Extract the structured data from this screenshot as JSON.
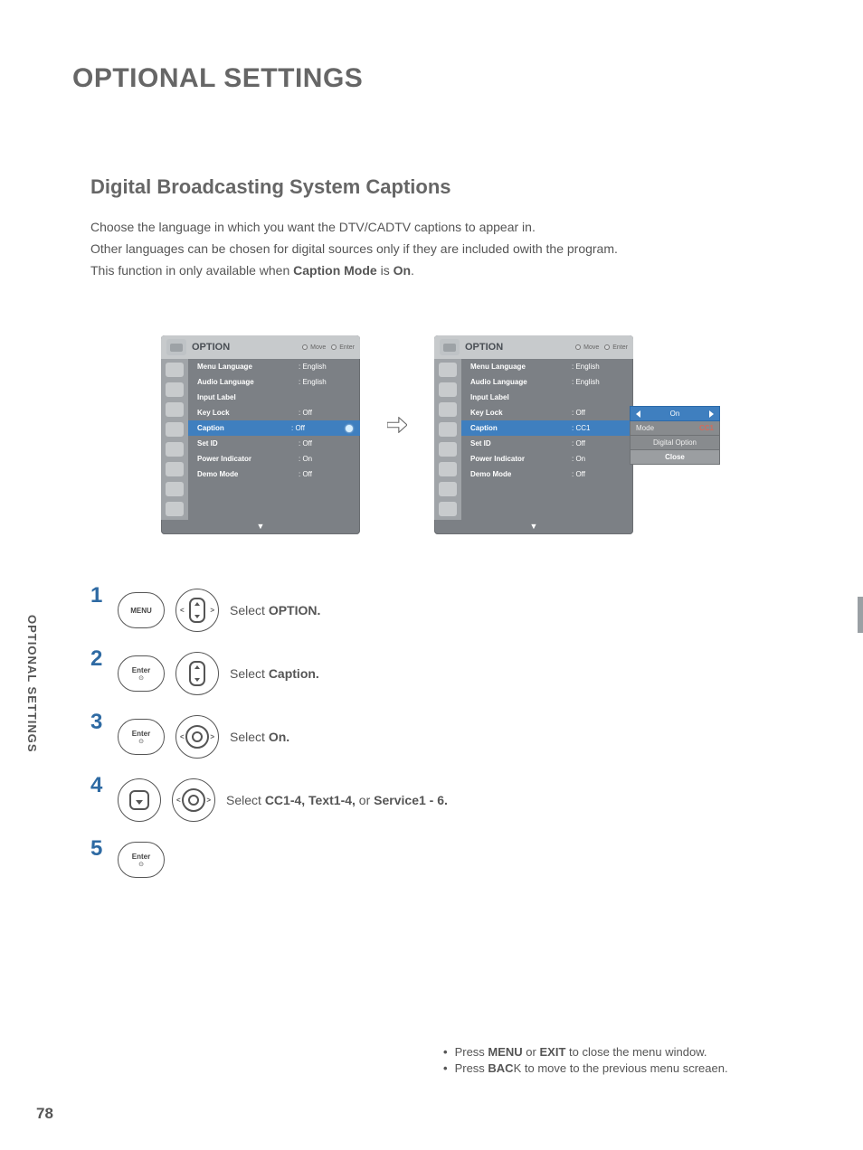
{
  "page_title": "OPTIONAL SETTINGS",
  "section_title": "Digital Broadcasting System Captions",
  "body_lines": [
    "Choose the language in which you want the DTV/CADTV captions to appear in.",
    "Other languages can be chosen for digital sources only if they are included owith the program."
  ],
  "body_suffix": {
    "pre": "This function in only available when ",
    "b1": "Caption Mode",
    "mid": " is ",
    "b2": "On",
    "post": "."
  },
  "osd": {
    "title": "OPTION",
    "move_hint": "Move",
    "enter_hint": "Enter",
    "rows_left": [
      {
        "label": "Menu Language",
        "val": ": English"
      },
      {
        "label": "Audio Language",
        "val": ": English"
      },
      {
        "label": "Input Label",
        "val": ""
      },
      {
        "label": "Key Lock",
        "val": ": Off"
      },
      {
        "label": "Caption",
        "val": ": Off",
        "sel": true,
        "dot": true
      },
      {
        "label": "Set ID",
        "val": ": Off"
      },
      {
        "label": "Power Indicator",
        "val": ": On"
      },
      {
        "label": "Demo Mode",
        "val": ": Off"
      }
    ],
    "rows_right": [
      {
        "label": "Menu Language",
        "val": ": English"
      },
      {
        "label": "Audio Language",
        "val": ": English"
      },
      {
        "label": "Input Label",
        "val": ""
      },
      {
        "label": "Key Lock",
        "val": ": Off"
      },
      {
        "label": "Caption",
        "val": ": CC1",
        "sel": true
      },
      {
        "label": "Set ID",
        "val": ": Off"
      },
      {
        "label": "Power Indicator",
        "val": ": On"
      },
      {
        "label": "Demo Mode",
        "val": ": Off"
      }
    ],
    "foot": "▼"
  },
  "popup": {
    "head": "On",
    "rows": [
      {
        "label": "Mode",
        "val": "CC1"
      },
      {
        "label": "Digital Option",
        "val": ""
      }
    ],
    "close": "Close"
  },
  "steps": [
    {
      "n": "1",
      "btn1": "MENU",
      "shape1": "rect",
      "shape2": "updown-chevlr",
      "text_pre": "Select ",
      "text_b": "OPTION.",
      "text_post": ""
    },
    {
      "n": "2",
      "btn1": "Enter",
      "shape1": "rect",
      "shape2": "updown",
      "text_pre": "Select ",
      "text_b": "Caption.",
      "text_post": ""
    },
    {
      "n": "3",
      "btn1": "Enter",
      "shape1": "rect",
      "shape2": "ring-chev",
      "text_pre": "Select ",
      "text_b": "On.",
      "text_post": ""
    },
    {
      "n": "4",
      "btn1": "",
      "shape1": "down",
      "shape2": "ring-chev",
      "text_pre": "Select ",
      "text_b": "CC1-4, Text1-4,",
      "text_post": " or ",
      "text_b2": "Service1 - 6."
    },
    {
      "n": "5",
      "btn1": "Enter",
      "shape1": "rect",
      "shape2": "",
      "text_pre": "",
      "text_b": "",
      "text_post": ""
    }
  ],
  "side_tab": "OPTIONAL SETTINGS",
  "footer": {
    "l1_pre": "Press ",
    "l1_b": "MENU",
    "l1_mid": " or ",
    "l1_b2": "EXIT",
    "l1_post": " to close the menu window.",
    "l2_pre": "Press ",
    "l2_b": "BAC",
    "l2_post": "K to move to the previous menu screaen."
  },
  "page_number": "78"
}
